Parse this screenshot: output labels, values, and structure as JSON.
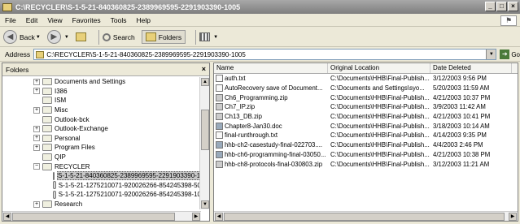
{
  "window": {
    "title": "C:\\RECYCLER\\S-1-5-21-840360825-2389969595-2291903390-1005",
    "buttons": [
      "_",
      "□",
      "×"
    ]
  },
  "menu": [
    "File",
    "Edit",
    "View",
    "Favorites",
    "Tools",
    "Help"
  ],
  "toolbar": {
    "back_label": "Back",
    "search_label": "Search",
    "folders_label": "Folders"
  },
  "address": {
    "label": "Address",
    "value": "C:\\RECYCLER\\S-1-5-21-840360825-2389969595-2291903390-1005",
    "go_label": "Go"
  },
  "folders_pane": {
    "title": "Folders",
    "items": [
      {
        "label": "Documents and Settings",
        "expander": "+"
      },
      {
        "label": "I386",
        "expander": "+"
      },
      {
        "label": "ISM",
        "expander": ""
      },
      {
        "label": "Misc",
        "expander": "+"
      },
      {
        "label": "Outlook-bck",
        "expander": ""
      },
      {
        "label": "Outlook-Exchange",
        "expander": "+"
      },
      {
        "label": "Personal",
        "expander": "+"
      },
      {
        "label": "Program Files",
        "expander": "+"
      },
      {
        "label": "QIP",
        "expander": ""
      },
      {
        "label": "RECYCLER",
        "expander": "−"
      },
      {
        "label": "S-1-5-21-840360825-2389969595-2291903390-1",
        "expander": "",
        "selected": true
      },
      {
        "label": "S-1-5-21-1275210071-920026266-854245398-50",
        "expander": ""
      },
      {
        "label": "S-1-5-21-1275210071-920026266-854245398-10",
        "expander": ""
      },
      {
        "label": "Research",
        "expander": "+"
      }
    ]
  },
  "files": {
    "columns": [
      "Name",
      "Original Location",
      "Date Deleted"
    ],
    "rows": [
      {
        "name": "auth.txt",
        "location": "C:\\Documents\\HHB\\Final-Publish...",
        "date": "3/12/2003 9:56 PM",
        "kind": "txt"
      },
      {
        "name": "AutoRecovery save of Document...",
        "location": "C:\\Documents and Settings\\syo...",
        "date": "5/20/2003 11:59 AM",
        "kind": "txt"
      },
      {
        "name": "Ch6_Programming.zip",
        "location": "C:\\Documents\\HHB\\Final-Publish...",
        "date": "4/21/2003 10:37 PM",
        "kind": "zip"
      },
      {
        "name": "Ch7_IP.zip",
        "location": "C:\\Documents\\HHB\\Final-Publish...",
        "date": "3/9/2003 11:42 AM",
        "kind": "zip"
      },
      {
        "name": "Ch13_DB.zip",
        "location": "C:\\Documents\\HHB\\Final-Publish...",
        "date": "4/21/2003 10:41 PM",
        "kind": "zip"
      },
      {
        "name": "Chapter8-Jan30.doc",
        "location": "C:\\Documents\\HHB\\Final-Publish...",
        "date": "3/18/2003 10:14 AM",
        "kind": "doc"
      },
      {
        "name": "final-runthrough.txt",
        "location": "C:\\Documents\\HHB\\Final-Publish...",
        "date": "4/14/2003 9:35 PM",
        "kind": "txt"
      },
      {
        "name": "hhb-ch2-casestudy-final-022703....",
        "location": "C:\\Documents\\HHB\\Final-Publish...",
        "date": "4/4/2003 2:46 PM",
        "kind": "doc"
      },
      {
        "name": "hhb-ch6-programming-final-03050...",
        "location": "C:\\Documents\\HHB\\Final-Publish...",
        "date": "4/21/2003 10:38 PM",
        "kind": "doc"
      },
      {
        "name": "hhb-ch8-protocols-final-030803.zip",
        "location": "C:\\Documents\\HHB\\Final-Publish...",
        "date": "3/12/2003 11:21 AM",
        "kind": "zip"
      }
    ]
  }
}
